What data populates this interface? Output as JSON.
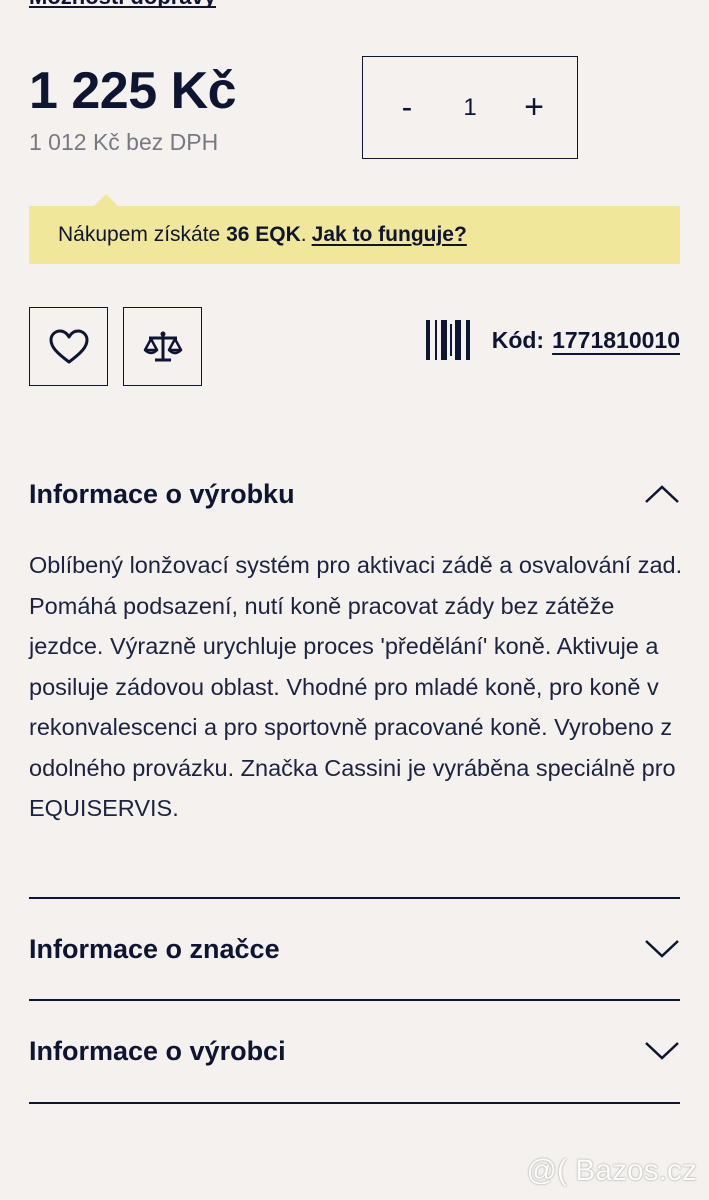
{
  "top_link": "Možnosti dopravy",
  "price": {
    "gross": "1 225 Kč",
    "net": "1 012 Kč bez DPH"
  },
  "quantity": {
    "minus_label": "-",
    "value": "1",
    "plus_label": "+"
  },
  "promo": {
    "prefix": "Nákupem získáte",
    "points": "36 EQK",
    "separator": ".",
    "link": "Jak to funguje?",
    "bg_color": "#f1e79a"
  },
  "actions": {
    "favorite_icon": "heart-icon",
    "compare_icon": "scales-icon"
  },
  "product_code": {
    "icon": "barcode-icon",
    "label": "Kód:",
    "value": "1771810010"
  },
  "accordion": [
    {
      "title": "Informace o výrobku",
      "expanded": true,
      "content": "Oblíbený lonžovací systém pro aktivaci zádě a osvalování zad. Pomáhá podsazení, nutí koně pracovat zády bez zátěže jezdce. Výrazně urychluje proces 'předělání' koně. Aktivuje a posiluje zádovou oblast. Vhodné pro mladé koně, pro koně v rekonvalescenci a pro sportovně pracované koně. Vyrobeno z odolného provázku. Značka Cassini je vyráběna speciálně pro EQUISERVIS."
    },
    {
      "title": "Informace o značce",
      "expanded": false
    },
    {
      "title": "Informace o výrobci",
      "expanded": false
    }
  ],
  "watermark": "@( Bazos.cz",
  "colors": {
    "background": "#f4f1ee",
    "text": "#0d1533",
    "muted": "#777a85"
  }
}
